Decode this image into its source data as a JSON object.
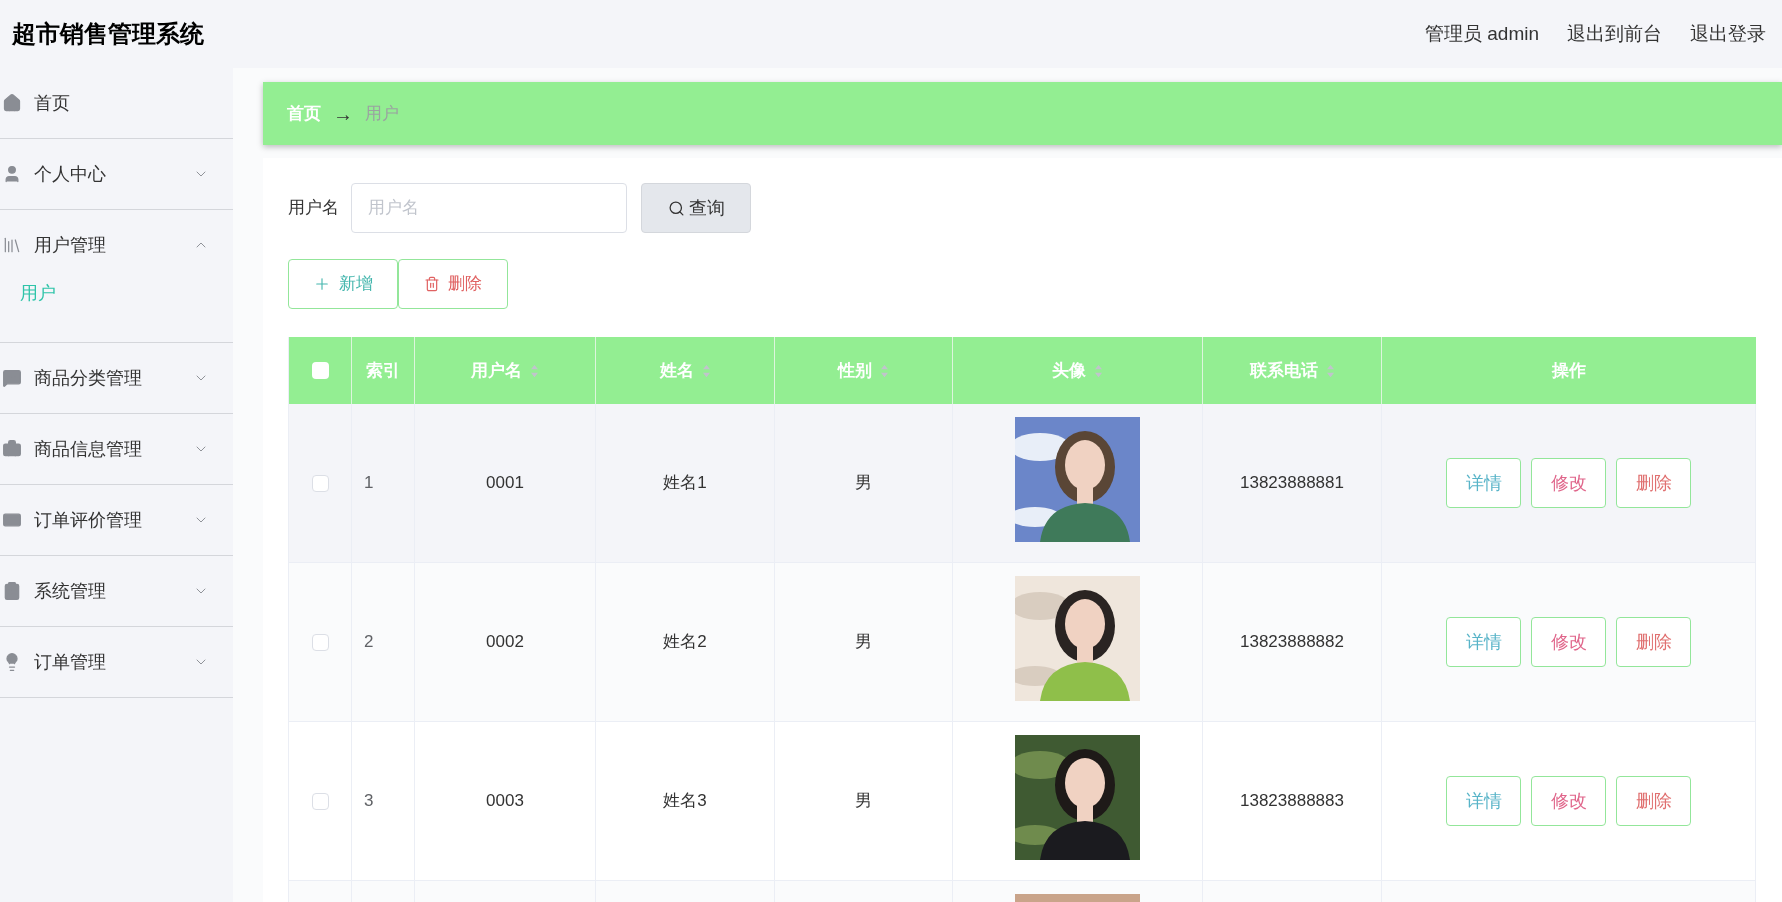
{
  "header": {
    "title": "超市销售管理系统",
    "links": [
      "管理员 admin",
      "退出到前台",
      "退出登录"
    ]
  },
  "sidebar": {
    "items": [
      {
        "label": "首页"
      },
      {
        "label": "个人中心",
        "expanded": false
      },
      {
        "label": "用户管理",
        "expanded": true,
        "children": [
          {
            "label": "用户",
            "selected": true
          }
        ]
      },
      {
        "label": "商品分类管理",
        "expanded": false
      },
      {
        "label": "商品信息管理",
        "expanded": false
      },
      {
        "label": "订单评价管理",
        "expanded": false
      },
      {
        "label": "系统管理",
        "expanded": false
      },
      {
        "label": "订单管理",
        "expanded": false
      }
    ]
  },
  "breadcrumb": [
    "首页",
    "→",
    "用户"
  ],
  "search": {
    "label": "用户名",
    "placeholder": "用户名",
    "button": "查询"
  },
  "actions": [
    {
      "label": "新增",
      "kind": "add"
    },
    {
      "label": "删除",
      "kind": "delete"
    }
  ],
  "table": {
    "select_all": {
      "checked": false
    },
    "columns": [
      {
        "label": "索引",
        "sortable": false
      },
      {
        "label": "用户名",
        "sortable": true
      },
      {
        "label": "姓名",
        "sortable": true
      },
      {
        "label": "性别",
        "sortable": true
      },
      {
        "label": "头像",
        "sortable": true
      },
      {
        "label": "联系电话",
        "sortable": true
      },
      {
        "label": "操作",
        "sortable": false
      }
    ],
    "rows": [
      {
        "checked": false,
        "index": "1",
        "username": "0001",
        "name": "姓名1",
        "gender": "男",
        "avatar": {
          "kind": "picture"
        },
        "phone": "13823888881",
        "buttons": [
          "详情",
          "修改",
          "删除"
        ]
      },
      {
        "checked": false,
        "index": "2",
        "username": "0002",
        "name": "姓名2",
        "gender": "男",
        "avatar": {
          "kind": "picture"
        },
        "phone": "13823888882",
        "buttons": [
          "详情",
          "修改",
          "删除"
        ]
      },
      {
        "checked": false,
        "index": "3",
        "username": "0003",
        "name": "姓名3",
        "gender": "男",
        "avatar": {
          "kind": "picture"
        },
        "phone": "13823888883",
        "buttons": [
          "详情",
          "修改",
          "删除"
        ]
      },
      {
        "avatar": {
          "kind": "picture"
        }
      }
    ]
  }
}
